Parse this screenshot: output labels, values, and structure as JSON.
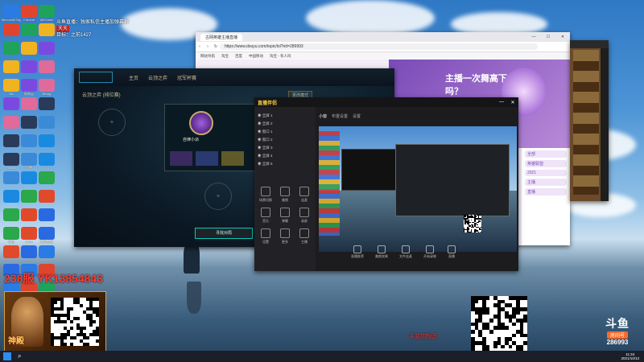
{
  "desktop": {
    "icons": [
      {
        "label": "Microsoft Edge"
      },
      {
        "label": "Chrome"
      },
      {
        "label": "WeGame"
      },
      {
        "label": "360"
      },
      {
        "label": "网易云"
      },
      {
        "label": "Bitwig"
      },
      {
        "label": "Steam"
      },
      {
        "label": "设置"
      },
      {
        "label": "QQ"
      },
      {
        "label": "微信"
      },
      {
        "label": "WPS"
      },
      {
        "label": "腾讯会议"
      }
    ],
    "notice_line1": "斗鱼直播：独家私信主播加弹幕群",
    "notice_line2": "天天",
    "notice_line3": "目标：之前1427",
    "phone_overlay": "238服 YK13854843",
    "shop_text": "手游加粉团"
  },
  "browser": {
    "tab_title": "古网英雄主播直播",
    "url": "https://www.douyu.com/topic/lol?rid=286993",
    "bookmarks": [
      "网站导航",
      "淘宝",
      "百度",
      "中国移动",
      "淘宝 - 有人吗"
    ],
    "banner_text": "主播一次舞高下，播吗？",
    "side_items": [
      "全部",
      "英雄联盟",
      "2021",
      "主播",
      "直播"
    ]
  },
  "lol": {
    "nav": [
      "主页",
      "云顶之弈",
      "冠军杯赛"
    ],
    "mode": "云顶之弈 (排位赛)",
    "player": "自律小派",
    "find_match": "寻找对局",
    "right_btn": "更改模式"
  },
  "obs": {
    "title": "直播伴侣",
    "sources": [
      "全屏 1",
      "全屏 2",
      "窗口 1",
      "窗口 2",
      "全屏 3",
      "全屏 4",
      "全屏 5"
    ],
    "tools": [
      "场景切换",
      "美颜",
      "连麦",
      "音乐",
      "弹幕",
      "录屏",
      "设置",
      "更多",
      "主播"
    ],
    "controls": [
      "直播推荐",
      "美颜效果",
      "文件连麦",
      "开始录制",
      "直播"
    ]
  },
  "room": {
    "platform": "斗鱼",
    "room_label": "房间号",
    "room_number": "286993"
  },
  "taskbar": {
    "time": "11:34",
    "date": "2021/10/13"
  }
}
